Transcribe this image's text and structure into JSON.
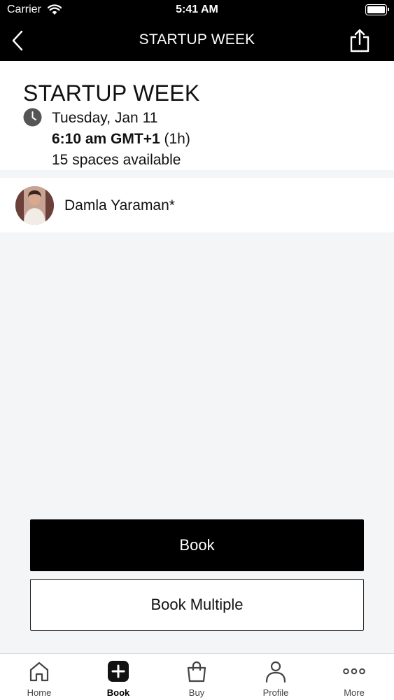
{
  "status_bar": {
    "carrier": "Carrier",
    "time": "5:41 AM"
  },
  "header": {
    "title": "STARTUP WEEK"
  },
  "event": {
    "title": "STARTUP WEEK",
    "date": "Tuesday, Jan 11",
    "time": "6:10 am GMT+1",
    "duration": "(1h)",
    "spaces": "15 spaces available"
  },
  "instructor": {
    "name": "Damla Yaraman*"
  },
  "actions": {
    "book_label": "Book",
    "book_multiple_label": "Book Multiple"
  },
  "tabs": [
    {
      "label": "Home",
      "icon": "home-icon"
    },
    {
      "label": "Book",
      "icon": "plus-square-icon",
      "active": true
    },
    {
      "label": "Buy",
      "icon": "shopping-bag-icon"
    },
    {
      "label": "Profile",
      "icon": "person-icon"
    },
    {
      "label": "More",
      "icon": "more-dots-icon"
    }
  ],
  "colors": {
    "header_bg": "#000000",
    "primary_button": "#000000",
    "background": "#f4f5f7"
  }
}
